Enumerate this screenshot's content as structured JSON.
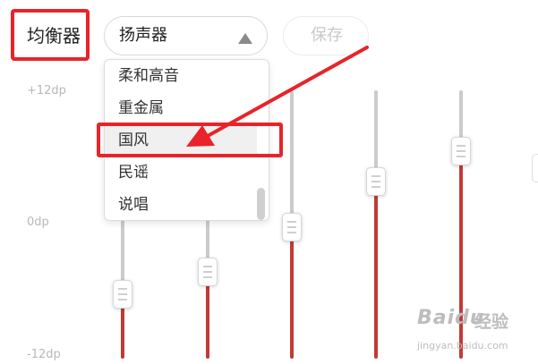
{
  "equalizer": {
    "title": "均衡器",
    "preset": {
      "selected": "扬声器",
      "options": [
        "柔和高音",
        "重金属",
        "国风",
        "民谣",
        "说唱"
      ],
      "highlighted": "国风"
    },
    "save_label": "保存",
    "axis": {
      "top": "+12dp",
      "middle": "0dp",
      "bottom": "-12dp"
    },
    "bands": [
      {
        "level": -0.52
      },
      {
        "level": -0.35
      },
      {
        "level": -0.02
      },
      {
        "level": 0.32
      },
      {
        "level": 0.55
      }
    ]
  },
  "colors": {
    "highlight": "#e8232a",
    "track_active": "#c33a35",
    "track_inactive": "#cbcbcb"
  },
  "watermark": {
    "brand": "Baidu",
    "suffix": "经验",
    "url": "jingyan.baidu.com"
  }
}
